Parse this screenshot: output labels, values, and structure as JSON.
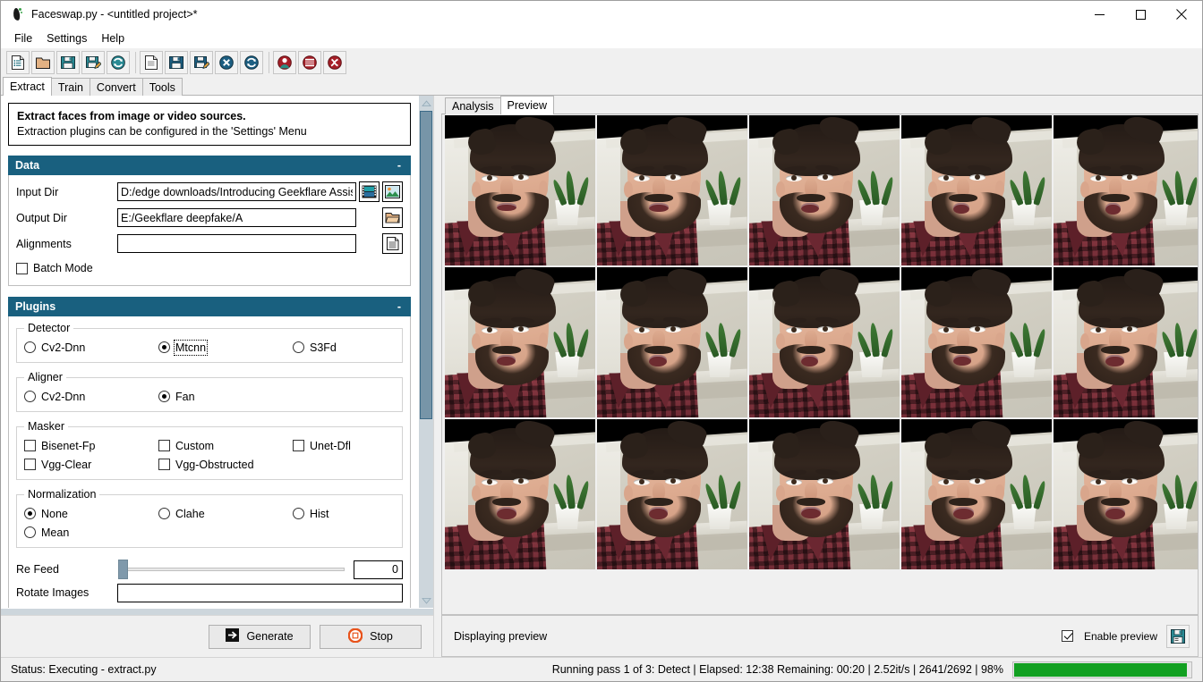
{
  "window": {
    "title": "Faceswap.py - <untitled project>*",
    "app_icon": "faceswap-logo-icon",
    "minimize_label": "Minimize",
    "maximize_label": "Maximize",
    "close_label": "Close"
  },
  "menubar": {
    "items": [
      {
        "label": "File"
      },
      {
        "label": "Settings"
      },
      {
        "label": "Help"
      }
    ]
  },
  "toolbar": {
    "groups": [
      {
        "buttons": [
          {
            "icon": "new-project-icon",
            "tooltip": "New Project"
          },
          {
            "icon": "open-folder-icon",
            "tooltip": "Open Project"
          },
          {
            "icon": "save-project-icon",
            "tooltip": "Save Project"
          },
          {
            "icon": "save-project-as-icon",
            "tooltip": "Save Project As"
          },
          {
            "icon": "reload-project-icon",
            "tooltip": "Reload Project"
          }
        ]
      },
      {
        "buttons": [
          {
            "icon": "new-task-icon",
            "tooltip": "New Task"
          },
          {
            "icon": "save-task-icon",
            "tooltip": "Save Task"
          },
          {
            "icon": "save-task-as-icon",
            "tooltip": "Save Task As"
          },
          {
            "icon": "clear-task-icon",
            "tooltip": "Clear Task"
          },
          {
            "icon": "reload-task-icon",
            "tooltip": "Reload Task"
          }
        ]
      },
      {
        "buttons": [
          {
            "icon": "extract-faces-icon",
            "tooltip": "Extract"
          },
          {
            "icon": "alignments-tool-icon",
            "tooltip": "Alignments"
          },
          {
            "icon": "effmpeg-tool-icon",
            "tooltip": "Effmpeg"
          }
        ]
      }
    ]
  },
  "main_tabs": {
    "active": "Extract",
    "items": [
      {
        "label": "Extract"
      },
      {
        "label": "Train"
      },
      {
        "label": "Convert"
      },
      {
        "label": "Tools"
      }
    ]
  },
  "info": {
    "line1": "Extract faces from image or video sources.",
    "line2": "Extraction plugins can be configured in the 'Settings' Menu"
  },
  "data_section": {
    "title": "Data",
    "collapse_label": "-",
    "fields": [
      {
        "label": "Input Dir",
        "value": "D:/edge downloads/Introducing Geekflare Assist (",
        "placeholder": "",
        "buttons": [
          {
            "icon": "film-strip-icon"
          },
          {
            "icon": "image-picker-icon"
          }
        ]
      },
      {
        "label": "Output Dir",
        "value": "E:/Geekflare deepfake/A",
        "placeholder": "",
        "buttons": [
          {
            "icon": "folder-browse-icon"
          }
        ]
      },
      {
        "label": "Alignments",
        "value": "",
        "placeholder": "",
        "buttons": [
          {
            "icon": "file-browse-icon"
          }
        ]
      }
    ],
    "batch_mode": {
      "label": "Batch Mode",
      "checked": false
    }
  },
  "plugins_section": {
    "title": "Plugins",
    "collapse_label": "-",
    "groups": [
      {
        "legend": "Detector",
        "type": "radio",
        "options": [
          {
            "label": "Cv2-Dnn",
            "selected": false,
            "focused": false
          },
          {
            "label": "Mtcnn",
            "selected": true,
            "focused": true
          },
          {
            "label": "S3Fd",
            "selected": false,
            "focused": false
          }
        ]
      },
      {
        "legend": "Aligner",
        "type": "radio",
        "options": [
          {
            "label": "Cv2-Dnn",
            "selected": false,
            "focused": false
          },
          {
            "label": "Fan",
            "selected": true,
            "focused": false
          }
        ]
      },
      {
        "legend": "Masker",
        "type": "checkbox",
        "options": [
          {
            "label": "Bisenet-Fp",
            "checked": false
          },
          {
            "label": "Custom",
            "checked": false
          },
          {
            "label": "Unet-Dfl",
            "checked": false
          },
          {
            "label": "Vgg-Clear",
            "checked": false
          },
          {
            "label": "Vgg-Obstructed",
            "checked": false
          }
        ]
      },
      {
        "legend": "Normalization",
        "type": "radio",
        "options": [
          {
            "label": "None",
            "selected": true,
            "focused": false
          },
          {
            "label": "Clahe",
            "selected": false,
            "focused": false
          },
          {
            "label": "Hist",
            "selected": false,
            "focused": false
          },
          {
            "label": "Mean",
            "selected": false,
            "focused": false
          }
        ]
      }
    ],
    "re_feed": {
      "label": "Re Feed",
      "value": "0",
      "min": "0",
      "max": "10"
    },
    "rotate_images": {
      "label": "Rotate Images",
      "value": ""
    }
  },
  "left_buttons": {
    "generate": {
      "label": "Generate",
      "icon": "generate-arrow-icon"
    },
    "stop": {
      "label": "Stop",
      "icon": "stop-circle-icon"
    }
  },
  "right_tabs": {
    "active": "Preview",
    "items": [
      {
        "label": "Analysis"
      },
      {
        "label": "Preview"
      }
    ]
  },
  "preview": {
    "columns": 5,
    "rows": 3,
    "thumb_alt": "extracted-face-thumbnail",
    "status_text": "Displaying preview",
    "enable_preview": {
      "label": "Enable preview",
      "checked": true
    },
    "save_icon": "save-preview-icon"
  },
  "statusbar": {
    "left": "Status: Executing - extract.py",
    "right": "Running pass 1 of 3: Detect  |  Elapsed: 12:38  Remaining: 00:20  |  2.52it/s  |  2641/2692  |  98%",
    "progress_percent": 98,
    "progress_color": "#12a021"
  },
  "colors": {
    "section_header": "#19607f",
    "progress_green": "#12a021",
    "window_bg": "#f0f0f0",
    "scrollbar_thumb": "#7795a8"
  }
}
